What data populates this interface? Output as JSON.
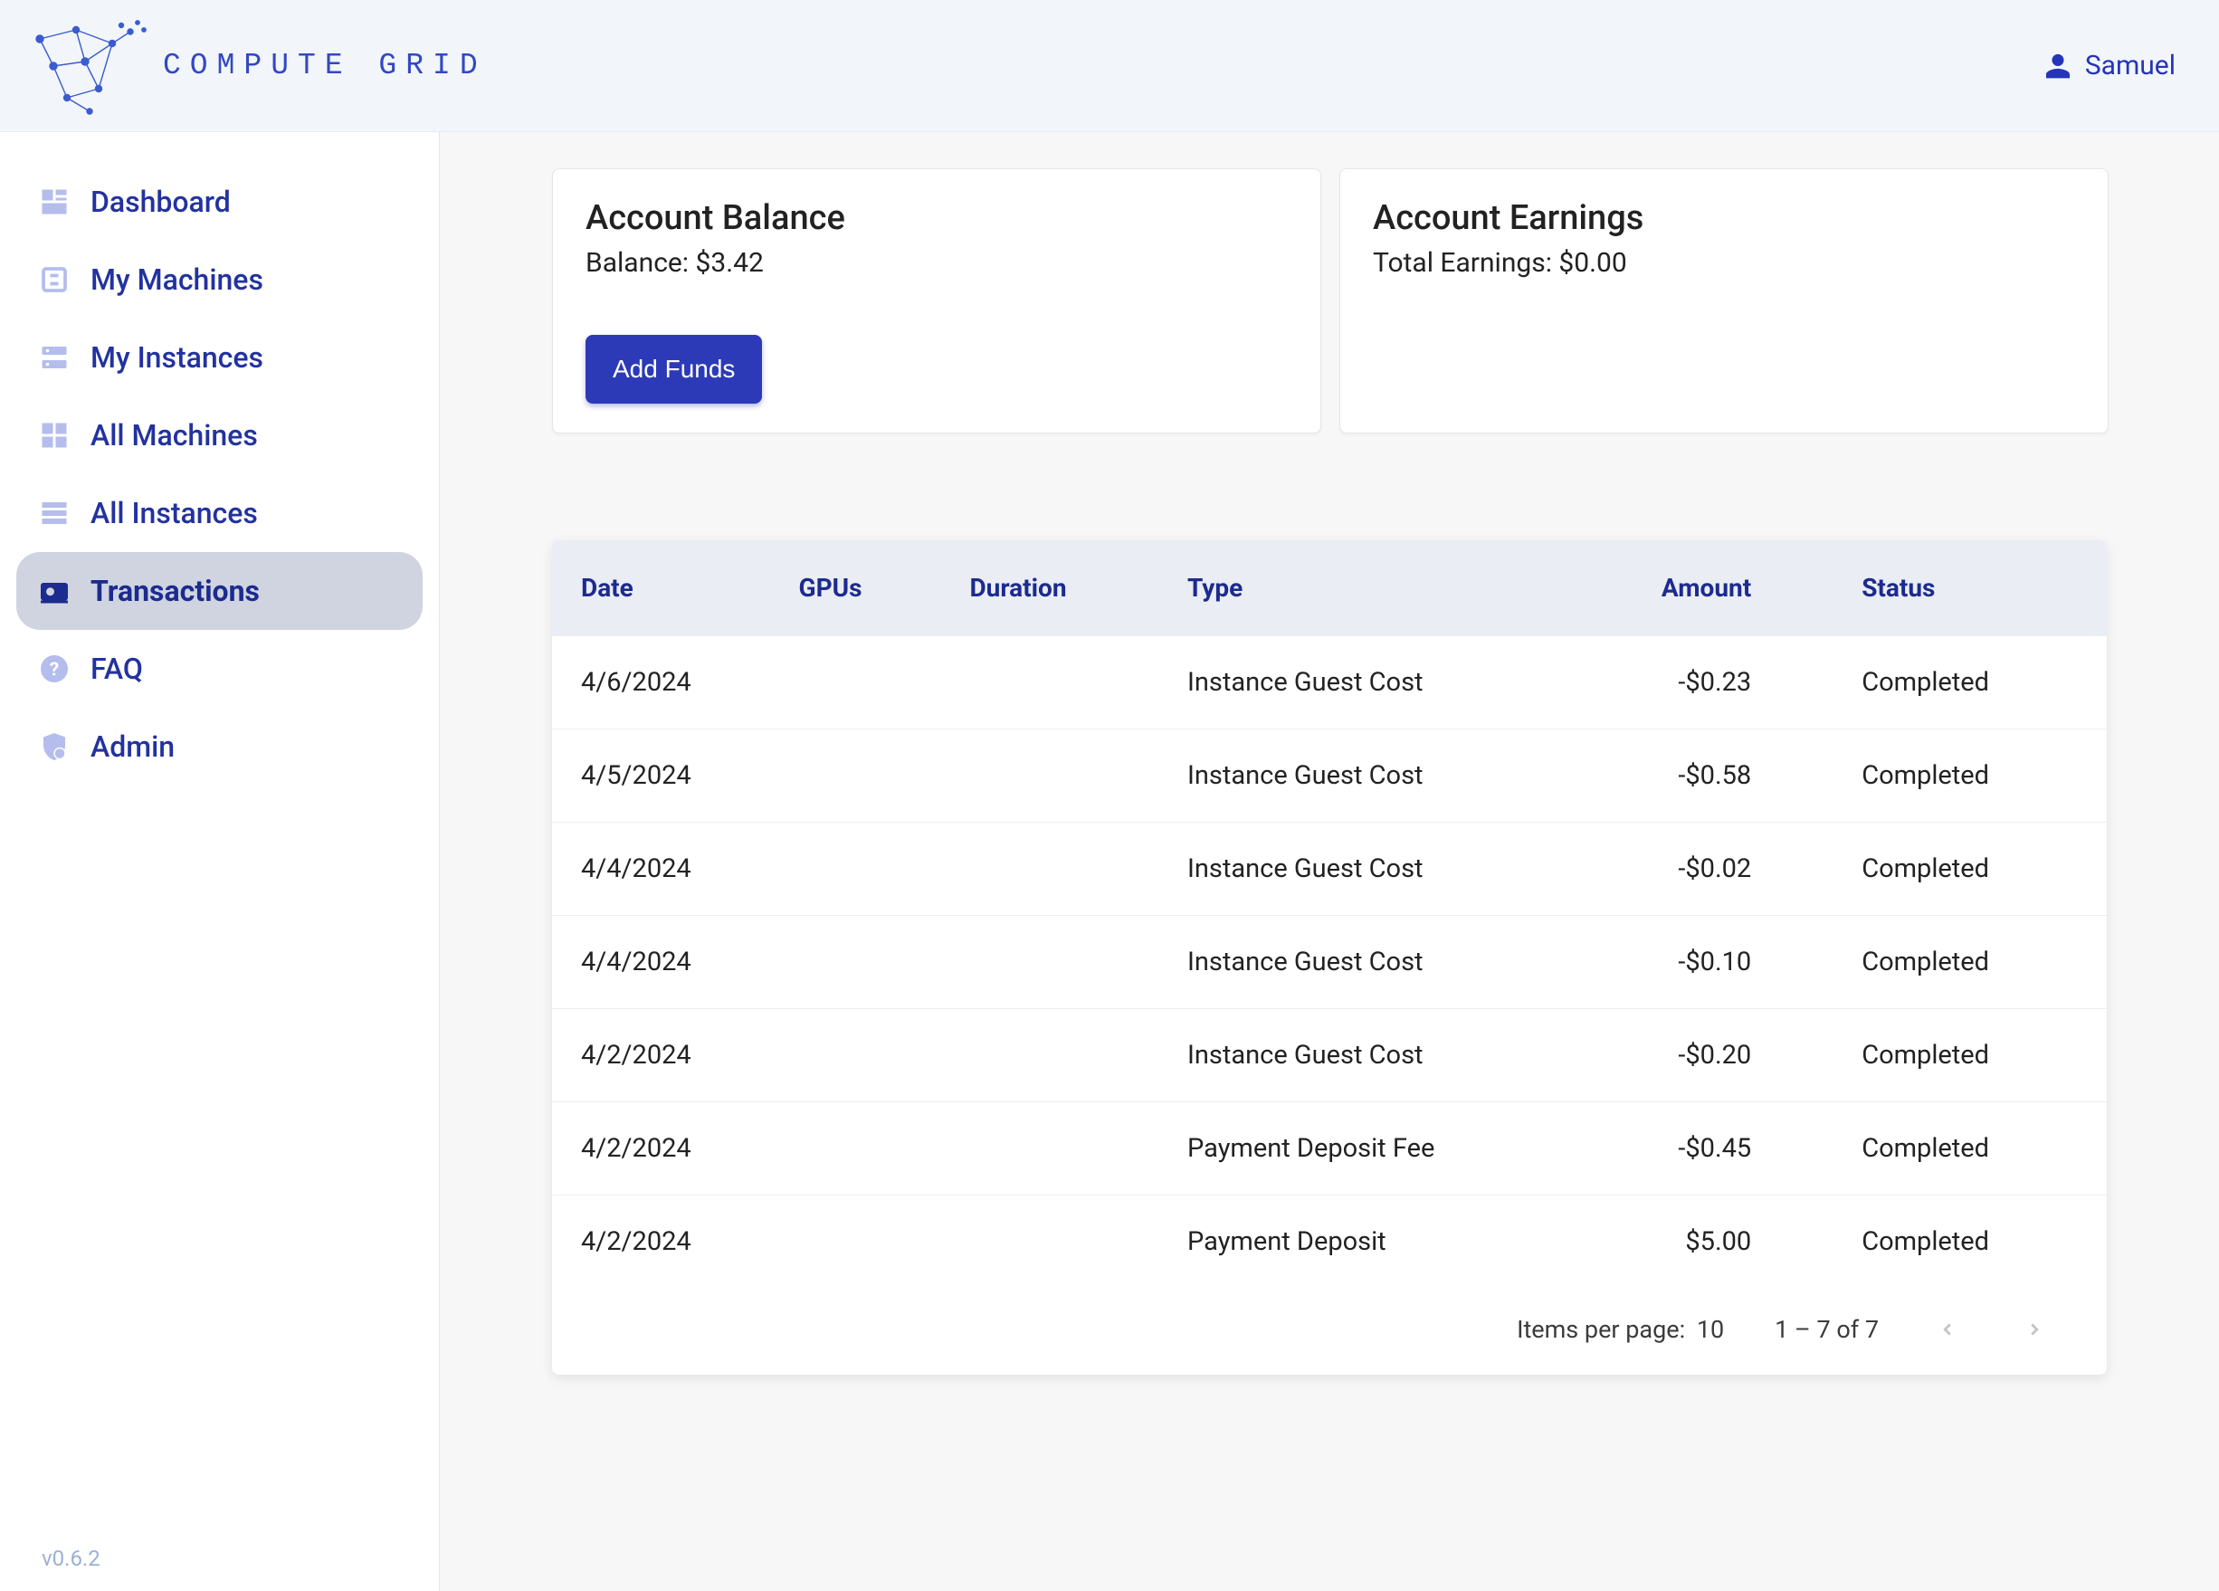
{
  "header": {
    "brand": "COMPUTE GRID",
    "user_name": "Samuel"
  },
  "sidebar": {
    "items": [
      {
        "label": "Dashboard",
        "active": false
      },
      {
        "label": "My Machines",
        "active": false
      },
      {
        "label": "My Instances",
        "active": false
      },
      {
        "label": "All Machines",
        "active": false
      },
      {
        "label": "All Instances",
        "active": false
      },
      {
        "label": "Transactions",
        "active": true
      },
      {
        "label": "FAQ",
        "active": false
      },
      {
        "label": "Admin",
        "active": false
      }
    ],
    "version": "v0.6.2"
  },
  "cards": {
    "balance": {
      "title": "Account Balance",
      "subtitle": "Balance: $3.42",
      "button": "Add Funds"
    },
    "earnings": {
      "title": "Account Earnings",
      "subtitle": "Total Earnings: $0.00"
    }
  },
  "table": {
    "headers": [
      "Date",
      "GPUs",
      "Duration",
      "Type",
      "Amount",
      "Status"
    ],
    "rows": [
      {
        "date": "4/6/2024",
        "gpus": "",
        "duration": "",
        "type": "Instance Guest Cost",
        "amount": "-$0.23",
        "status": "Completed"
      },
      {
        "date": "4/5/2024",
        "gpus": "",
        "duration": "",
        "type": "Instance Guest Cost",
        "amount": "-$0.58",
        "status": "Completed"
      },
      {
        "date": "4/4/2024",
        "gpus": "",
        "duration": "",
        "type": "Instance Guest Cost",
        "amount": "-$0.02",
        "status": "Completed"
      },
      {
        "date": "4/4/2024",
        "gpus": "",
        "duration": "",
        "type": "Instance Guest Cost",
        "amount": "-$0.10",
        "status": "Completed"
      },
      {
        "date": "4/2/2024",
        "gpus": "",
        "duration": "",
        "type": "Instance Guest Cost",
        "amount": "-$0.20",
        "status": "Completed"
      },
      {
        "date": "4/2/2024",
        "gpus": "",
        "duration": "",
        "type": "Payment Deposit Fee",
        "amount": "-$0.45",
        "status": "Completed"
      },
      {
        "date": "4/2/2024",
        "gpus": "",
        "duration": "",
        "type": "Payment Deposit",
        "amount": "$5.00",
        "status": "Completed"
      }
    ]
  },
  "paginator": {
    "items_per_page_label": "Items per page:",
    "items_per_page_value": "10",
    "range": "1 – 7 of 7"
  }
}
